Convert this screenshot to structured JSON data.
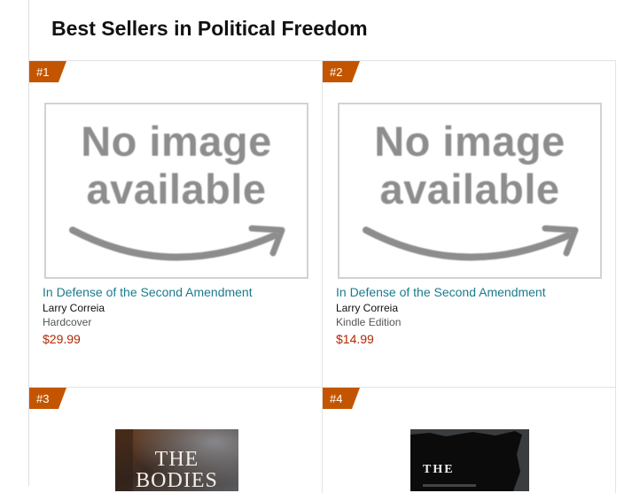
{
  "heading": "Best Sellers in Political Freedom",
  "products": [
    {
      "rank": "#1",
      "title": "In Defense of the Second Amendment",
      "author": "Larry Correia",
      "format": "Hardcover",
      "price": "$29.99",
      "placeholder_line1": "No image",
      "placeholder_line2": "available"
    },
    {
      "rank": "#2",
      "title": "In Defense of the Second Amendment",
      "author": "Larry Correia",
      "format": "Kindle Edition",
      "price": "$14.99",
      "placeholder_line1": "No image",
      "placeholder_line2": "available"
    },
    {
      "rank": "#3",
      "cover_text": "THE BODIES"
    },
    {
      "rank": "#4",
      "cover_text": "THE"
    }
  ],
  "colors": {
    "rank_badge": "#c45500",
    "link": "#1a7b8c",
    "price": "#b12704"
  }
}
